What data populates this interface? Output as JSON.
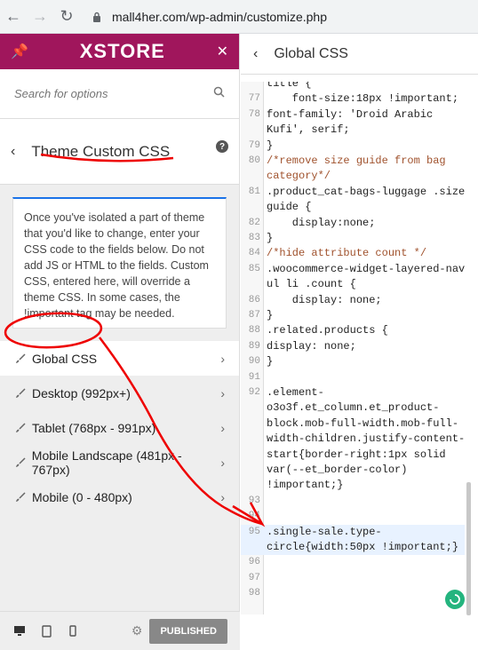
{
  "browser": {
    "url": "mall4her.com/wp-admin/customize.php"
  },
  "sidebar": {
    "brand": "XSTORE",
    "search_placeholder": "Search for options",
    "section_title": "Theme Custom CSS",
    "description": "Once you've isolated a part of theme that you'd like to change, enter your CSS code to the fields below. Do not add JS or HTML to the fields. Custom CSS, entered here, will override a theme CSS. In some cases, the !important tag may be needed.",
    "items": [
      {
        "label": "Global CSS"
      },
      {
        "label": "Desktop (992px+)"
      },
      {
        "label": "Tablet (768px - 991px)"
      },
      {
        "label": "Mobile Landscape (481px - 767px)"
      },
      {
        "label": "Mobile (0 - 480px)"
      }
    ],
    "published_label": "PUBLISHED"
  },
  "editor": {
    "title": "Global CSS",
    "lines": [
      {
        "n": "",
        "t": "title {"
      },
      {
        "n": "77",
        "t": "    font-size:18px !important;"
      },
      {
        "n": "78",
        "t": "font-family: 'Droid Arabic"
      },
      {
        "n": "",
        "t": "Kufi', serif;"
      },
      {
        "n": "79",
        "t": "}"
      },
      {
        "n": "80",
        "t": "/*remove size guide from bag"
      },
      {
        "n": "",
        "t": "category*/"
      },
      {
        "n": "81",
        "t": ".product_cat-bags-luggage .size-"
      },
      {
        "n": "",
        "t": "guide {"
      },
      {
        "n": "82",
        "t": "    display:none;"
      },
      {
        "n": "83",
        "t": "}"
      },
      {
        "n": "84",
        "t": "/*hide attribute count */"
      },
      {
        "n": "85",
        "t": ".woocommerce-widget-layered-nav"
      },
      {
        "n": "",
        "t": "ul li .count {"
      },
      {
        "n": "86",
        "t": "    display: none;"
      },
      {
        "n": "87",
        "t": "}"
      },
      {
        "n": "88",
        "t": ".related.products {"
      },
      {
        "n": "89",
        "t": "display: none;"
      },
      {
        "n": "90",
        "t": "}"
      },
      {
        "n": "91",
        "t": ""
      },
      {
        "n": "92",
        "t": ".element-"
      },
      {
        "n": "",
        "t": "o3o3f.et_column.et_product-"
      },
      {
        "n": "",
        "t": "block.mob-full-width.mob-full-"
      },
      {
        "n": "",
        "t": "width-children.justify-content-"
      },
      {
        "n": "",
        "t": "start{border-right:1px solid"
      },
      {
        "n": "",
        "t": "var(--et_border-color)"
      },
      {
        "n": "",
        "t": "!important;}"
      },
      {
        "n": "93",
        "t": ""
      },
      {
        "n": "94",
        "t": ""
      },
      {
        "n": "95",
        "t": ".single-sale.type-"
      },
      {
        "n": "",
        "t": "circle{width:50px !important;}"
      },
      {
        "n": "96",
        "t": ""
      },
      {
        "n": "97",
        "t": ""
      },
      {
        "n": "98",
        "t": ""
      }
    ]
  }
}
